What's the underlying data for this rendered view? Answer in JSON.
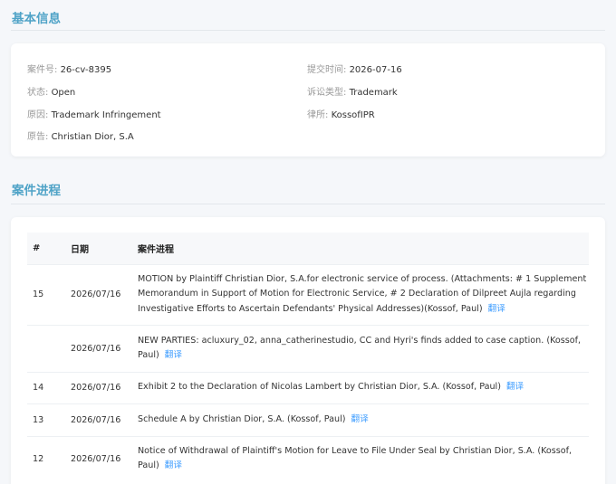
{
  "basic": {
    "title": "基本信息",
    "case_no": {
      "label": "案件号:",
      "value": "26-cv-8395"
    },
    "submit_time": {
      "label": "提交时间:",
      "value": "2026-07-16"
    },
    "status": {
      "label": "状态:",
      "value": "Open"
    },
    "suit_type": {
      "label": "诉讼类型:",
      "value": "Trademark"
    },
    "cause": {
      "label": "原因:",
      "value": "Trademark Infringement"
    },
    "law_firm": {
      "label": "律所:",
      "value": "KossofIPR"
    },
    "plaintiff": {
      "label": "原告:",
      "value": "Christian Dior, S.A"
    }
  },
  "progress": {
    "title": "案件进程",
    "headers": [
      "#",
      "日期",
      "案件进程"
    ],
    "translate_label": "翻译",
    "rows": [
      {
        "num": "15",
        "date": "2026/07/16",
        "text": "MOTION by Plaintiff Christian Dior, S.A.for electronic service of process. (Attachments: # 1 Supplement Memorandum in Support of Motion for Electronic Service, # 2 Declaration of Dilpreet Aujla regarding Investigative Efforts to Ascertain Defendants' Physical Addresses)(Kossof, Paul)"
      },
      {
        "num": "",
        "date": "2026/07/16",
        "text": "NEW PARTIES: acluxury_02, anna_catherinestudio, CC and Hyri's finds added to case caption. (Kossof, Paul)"
      },
      {
        "num": "14",
        "date": "2026/07/16",
        "text": "Exhibit 2 to the Declaration of Nicolas Lambert by Christian Dior, S.A. (Kossof, Paul)"
      },
      {
        "num": "13",
        "date": "2026/07/16",
        "text": "Schedule A by Christian Dior, S.A. (Kossof, Paul)"
      },
      {
        "num": "12",
        "date": "2026/07/16",
        "text": "Notice of Withdrawal of Plaintiff's Motion for Leave to File Under Seal by Christian Dior, S.A. (Kossof, Paul)"
      }
    ]
  }
}
